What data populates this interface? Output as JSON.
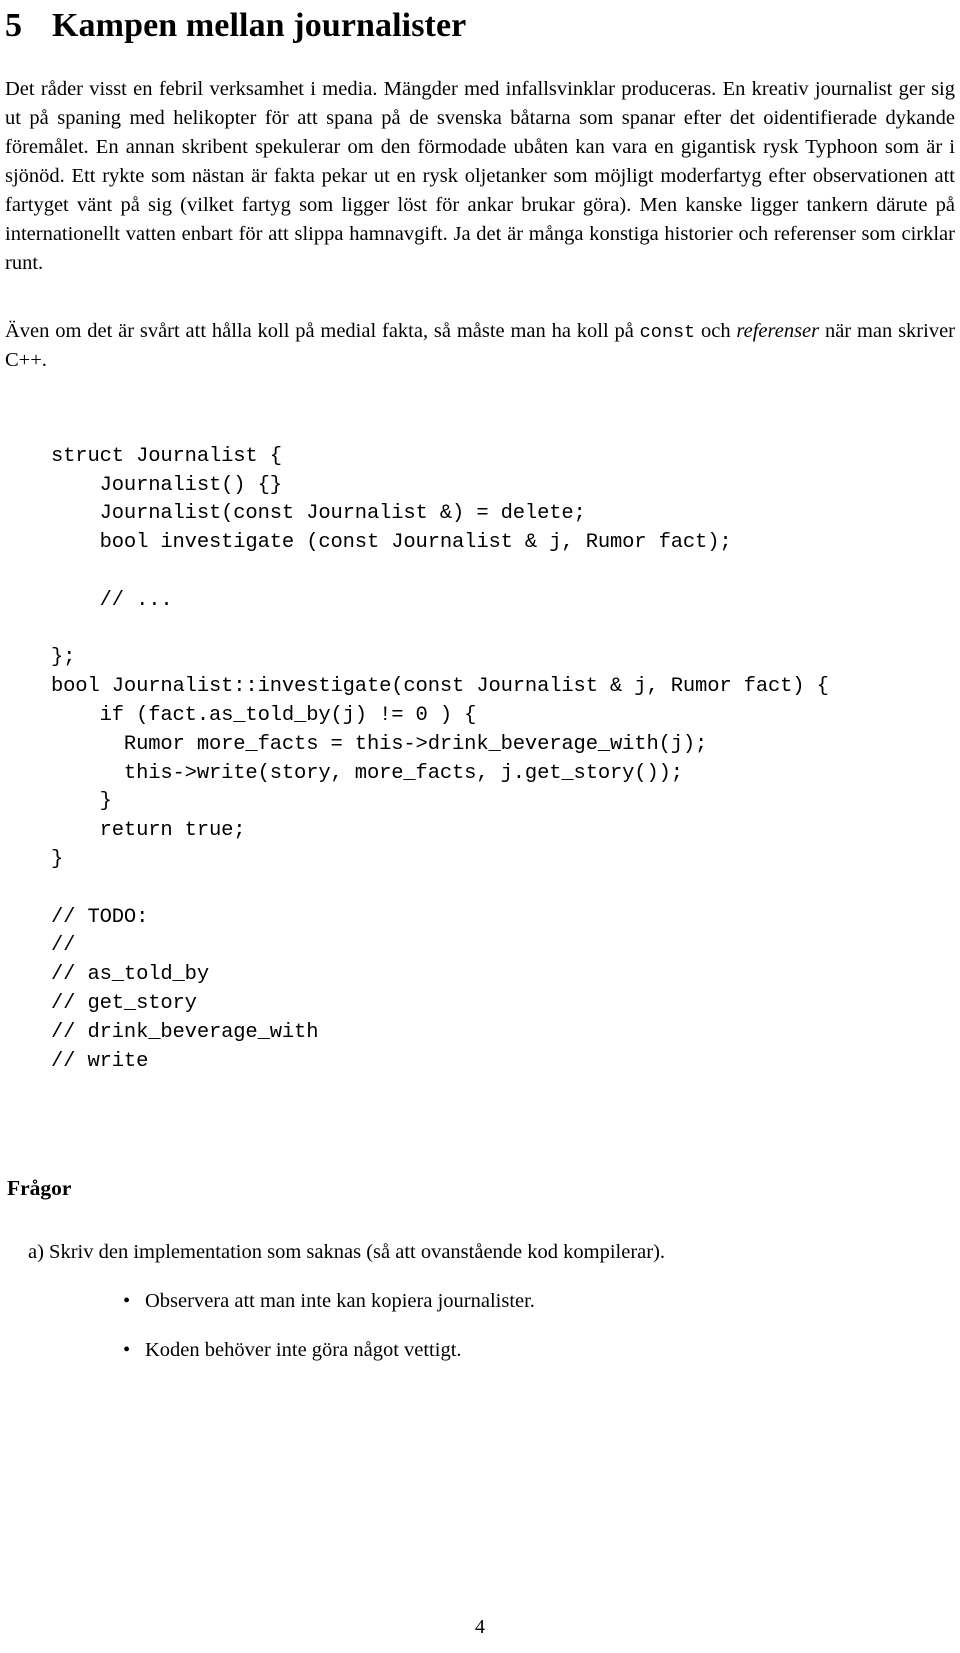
{
  "document": {
    "section": {
      "number": "5",
      "title": "Kampen mellan journalister"
    },
    "paragraphs": {
      "intro_part1": "Det råder visst en febril verksamhet i media. Mängder med infallsvinklar produceras. En kreativ journalist ger sig ut på spaning med helikopter för att spana på de svenska båtarna som spanar efter det oidentifierade dykande föremålet. En annan skribent spekulerar om den förmodade ubåten kan vara en gigantisk rysk Typhoon som är i sjönöd. Ett rykte som nästan är fakta pekar ut en rysk oljetanker som möjligt moderfartyg efter observationen att fartyget vänt på sig (vilket fartyg som ligger löst för ankar brukar göra). Men kanske ligger tankern därute på internationellt vatten enbart för att slippa hamnavgift. Ja det är många konstiga historier och referenser som cirklar runt.",
      "second_lead": "Även om det är svårt att hålla koll på medial fakta, så måste man ha koll på ",
      "second_mono": "const",
      "second_mid": " och ",
      "second_italic": "referenser",
      "second_tail": " när man skriver C++."
    },
    "code_blocks": {
      "struct_definition": "struct Journalist {\n    Journalist() {}\n    Journalist(const Journalist &) = delete;\n    bool investigate (const Journalist & j, Rumor fact);\n\n    // ...\n\n};",
      "implementation": "bool Journalist::investigate(const Journalist & j, Rumor fact) {\n    if (fact.as_told_by(j) != 0 ) {\n      Rumor more_facts = this->drink_beverage_with(j);\n      this->write(story, more_facts, j.get_story());\n    }\n    return true;\n}\n\n// TODO:\n//\n// as_told_by\n// get_story\n// drink_beverage_with\n// write"
    },
    "questions": {
      "heading": "Frågor",
      "item_a": "a) Skriv den implementation som saknas (så att ovanstående kod kompilerar).",
      "bullets": [
        {
          "marker": "•",
          "text": "Observera att man inte kan kopiera journalister."
        },
        {
          "marker": "•",
          "text": "Koden behöver inte göra något vettigt."
        }
      ]
    },
    "footer": {
      "page_number": "4"
    }
  }
}
